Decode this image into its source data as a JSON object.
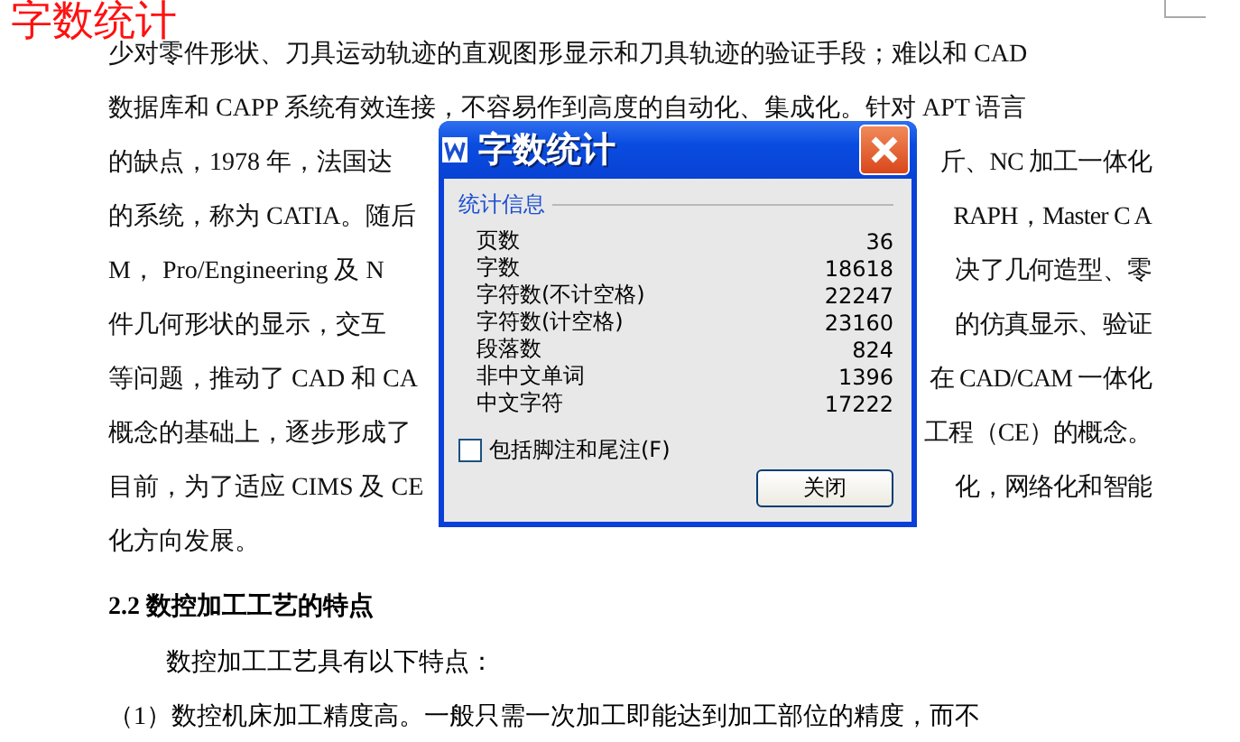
{
  "overlay_caption": "字数统计",
  "document": {
    "lines": [
      {
        "left": "少对零件形状、刀具运动轨迹的直观图形显示和刀具轨迹的验证手段；难以和 CAD"
      },
      {
        "left": "数据库和 CAPP 系统有效连接，不容易作到高度的自动化、集成化。针对 APT 语言"
      },
      {
        "left": "的缺点，1978 年，法国达",
        "right": "斤、NC 加工一体化"
      },
      {
        "left": "的系统，称为 CATIA。随后",
        "right": "RAPH，Master C A"
      },
      {
        "left": "M，  Pro/Engineering 及 N",
        "right": "决了几何造型、零"
      },
      {
        "left": "件几何形状的显示，交互",
        "right": "的仿真显示、验证"
      },
      {
        "left": "等问题，推动了 CAD 和 CA",
        "right": "在 CAD/CAM 一体化"
      },
      {
        "left": "概念的基础上，逐步形成了",
        "right": "工程（CE）的概念。"
      },
      {
        "left": "目前，为了适应 CIMS 及 CE",
        "right": "化，网络化和智能"
      },
      {
        "left": "化方向发展。"
      }
    ],
    "heading": "2.2  数控加工工艺的特点",
    "paragraphs": [
      "数控加工工艺具有以下特点：",
      "（1）数控机床加工精度高。一般只需一次加工即能达到加工部位的精度，而不"
    ]
  },
  "dialog": {
    "title": "字数统计",
    "group_label": "统计信息",
    "stats": [
      {
        "label": "页数",
        "value": "36"
      },
      {
        "label": "字数",
        "value": "18618"
      },
      {
        "label": "字符数(不计空格)",
        "value": "22247"
      },
      {
        "label": "字符数(计空格)",
        "value": "23160"
      },
      {
        "label": "段落数",
        "value": "824"
      },
      {
        "label": "非中文单词",
        "value": "1396"
      },
      {
        "label": "中文字符",
        "value": "17222"
      }
    ],
    "footnotes_checkbox": {
      "label": "包括脚注和尾注(F)",
      "checked": false
    },
    "buttons": [
      "关闭"
    ]
  }
}
